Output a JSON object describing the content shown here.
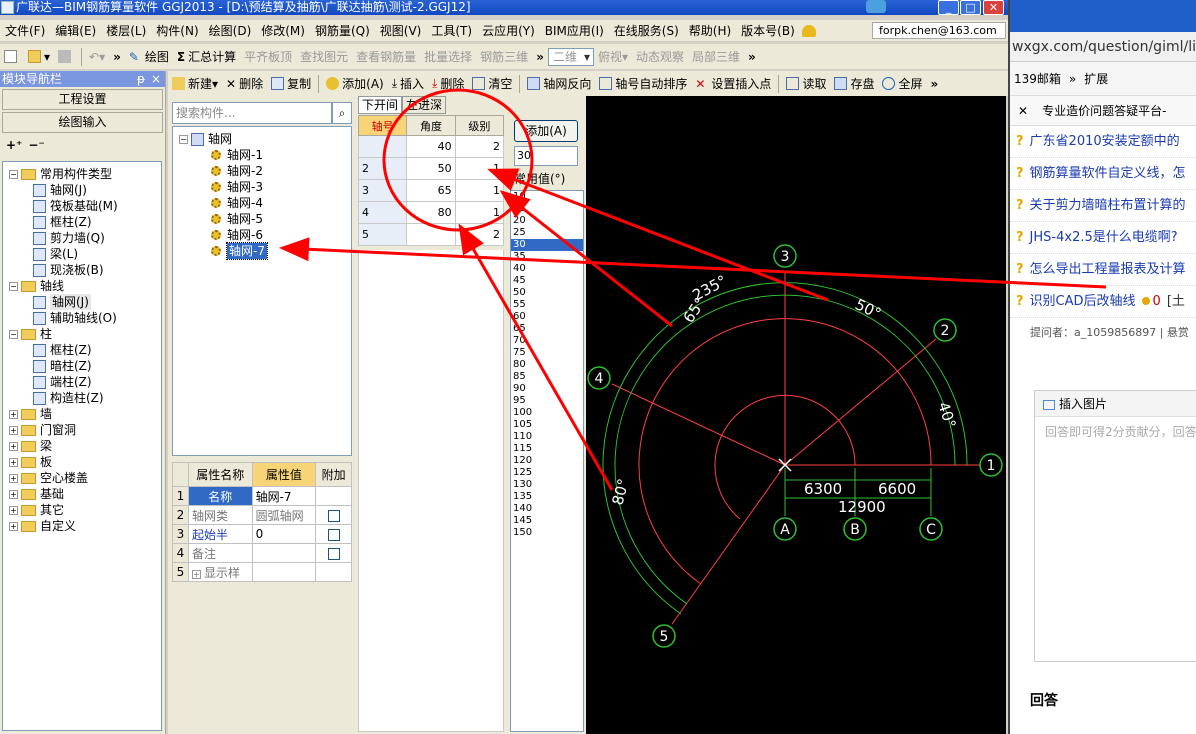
{
  "window": {
    "title": "广联达—BIM钢筋算量软件 GGJ2013 - [D:\\预结算及抽筋\\广联达抽筋\\测试-2.GGJ12]",
    "min": "_",
    "max": "□",
    "close": "✕"
  },
  "menu": {
    "items": [
      "文件(F)",
      "编辑(E)",
      "楼层(L)",
      "构件(N)",
      "绘图(D)",
      "修改(M)",
      "钢筋量(Q)",
      "视图(V)",
      "工具(T)",
      "云应用(Y)",
      "BIM应用(I)",
      "在线服务(S)",
      "帮助(H)",
      "版本号(B)"
    ],
    "user_email": "forpk.chen@163.com"
  },
  "toolbar1": {
    "draw": "绘图",
    "sum": "汇总计算",
    "align_top": "平齐板顶",
    "find": "查找图元",
    "view_rebar": "查看钢筋量",
    "batch": "批量选择",
    "rebar3d": "钢筋三维",
    "view2d": "二维",
    "bird": "俯视",
    "dynamic": "动态观察",
    "local3d": "局部三维"
  },
  "nav": {
    "title": "模块导航栏",
    "pin": "ᵽ",
    "close": "×",
    "project_settings": "工程设置",
    "drawing_input": "绘图输入",
    "tree": [
      {
        "label": "常用构件类型",
        "level": 0,
        "type": "folder",
        "exp": "−"
      },
      {
        "label": "轴网(J)",
        "level": 1,
        "type": "comp"
      },
      {
        "label": "筏板基础(M)",
        "level": 1,
        "type": "comp"
      },
      {
        "label": "框柱(Z)",
        "level": 1,
        "type": "comp"
      },
      {
        "label": "剪力墙(Q)",
        "level": 1,
        "type": "comp"
      },
      {
        "label": "梁(L)",
        "level": 1,
        "type": "comp"
      },
      {
        "label": "现浇板(B)",
        "level": 1,
        "type": "comp"
      },
      {
        "label": "轴线",
        "level": 0,
        "type": "folder",
        "exp": "−"
      },
      {
        "label": "轴网(J)",
        "level": 1,
        "type": "comp",
        "selected": true
      },
      {
        "label": "辅助轴线(O)",
        "level": 1,
        "type": "comp"
      },
      {
        "label": "柱",
        "level": 0,
        "type": "folder",
        "exp": "−"
      },
      {
        "label": "框柱(Z)",
        "level": 1,
        "type": "comp"
      },
      {
        "label": "暗柱(Z)",
        "level": 1,
        "type": "comp"
      },
      {
        "label": "端柱(Z)",
        "level": 1,
        "type": "comp"
      },
      {
        "label": "构造柱(Z)",
        "level": 1,
        "type": "comp"
      },
      {
        "label": "墙",
        "level": 0,
        "type": "folder",
        "exp": "+"
      },
      {
        "label": "门窗洞",
        "level": 0,
        "type": "folder",
        "exp": "+"
      },
      {
        "label": "梁",
        "level": 0,
        "type": "folder",
        "exp": "+"
      },
      {
        "label": "板",
        "level": 0,
        "type": "folder",
        "exp": "+"
      },
      {
        "label": "空心楼盖",
        "level": 0,
        "type": "folder",
        "exp": "+"
      },
      {
        "label": "基础",
        "level": 0,
        "type": "folder",
        "exp": "+"
      },
      {
        "label": "其它",
        "level": 0,
        "type": "folder",
        "exp": "+"
      },
      {
        "label": "自定义",
        "level": 0,
        "type": "folder",
        "exp": "+"
      }
    ]
  },
  "comp_toolbar": {
    "new": "新建",
    "delete": "删除",
    "copy": "复制",
    "add": "添加(A)",
    "insert": "插入",
    "delete2": "删除",
    "clear": "清空",
    "reverse": "轴网反向",
    "auto_sort": "轴号自动排序",
    "set_insert": "设置插入点",
    "read": "读取",
    "save": "存盘",
    "fullscreen": "全屏"
  },
  "components": {
    "search_placeholder": "搜索构件...",
    "search_icon": "⌕",
    "root": "轴网",
    "items": [
      "轴网-1",
      "轴网-2",
      "轴网-3",
      "轴网-4",
      "轴网-5",
      "轴网-6",
      "轴网-7"
    ],
    "selected": "轴网-7"
  },
  "properties": {
    "headers": [
      "属性名称",
      "属性值",
      "附加"
    ],
    "rows": [
      {
        "n": "1",
        "name": "名称",
        "value": "轴网-7",
        "check": false
      },
      {
        "n": "2",
        "name": "轴网类",
        "value": "圆弧轴网",
        "check": true
      },
      {
        "n": "3",
        "name": "起始半",
        "value": "0",
        "check": true
      },
      {
        "n": "4",
        "name": "备注",
        "value": "",
        "check": true
      },
      {
        "n": "5",
        "name": "显示样",
        "value": "",
        "check": false
      }
    ]
  },
  "axis_grid": {
    "tabs": [
      "下开间",
      "左进深"
    ],
    "headers": [
      "轴号",
      "角度",
      "级别"
    ],
    "rows": [
      {
        "axis": "",
        "angle": "40",
        "level": "2"
      },
      {
        "axis": "2",
        "angle": "50",
        "level": "1"
      },
      {
        "axis": "3",
        "angle": "65",
        "level": "1"
      },
      {
        "axis": "4",
        "angle": "80",
        "level": "1"
      },
      {
        "axis": "5",
        "angle": "",
        "level": "2"
      }
    ],
    "add_button": "添加(A)",
    "angle_input": "30",
    "common_label": "常用值(°)",
    "common_values": [
      "10",
      "15",
      "20",
      "25",
      "30",
      "35",
      "40",
      "45",
      "50",
      "55",
      "60",
      "65",
      "70",
      "75",
      "80",
      "85",
      "90",
      "95",
      "100",
      "105",
      "110",
      "115",
      "120",
      "125",
      "130",
      "135",
      "140",
      "145",
      "150"
    ],
    "selected_common": "30"
  },
  "canvas": {
    "axis_labels": [
      "1",
      "2",
      "3",
      "4",
      "5",
      "A",
      "B",
      "C"
    ],
    "angle_labels": [
      "235°",
      "65°",
      "50°",
      "40°",
      "80°"
    ],
    "dims": [
      "6300",
      "6600",
      "12900"
    ]
  },
  "browser": {
    "url": "wxgx.com/question/giml/list",
    "bookmarks": [
      "139邮箱",
      "»",
      "扩展"
    ],
    "tab": "专业造价问题答疑平台-",
    "questions": [
      "广东省2010安装定额中的",
      "钢筋算量软件自定义线，怎",
      "关于剪力墙暗柱布置计算的",
      "JHS-4x2.5是什么电缆啊?",
      "怎么导出工程量报表及计算",
      "识别CAD后改轴线"
    ],
    "q6_count": "0",
    "q6_tag": "[土",
    "asker": "提问者：a_1059856897  |  悬赏",
    "insert_image": "插入图片",
    "answer_placeholder": "回答即可得2分贡献分，回答",
    "answer_title": "回答"
  }
}
